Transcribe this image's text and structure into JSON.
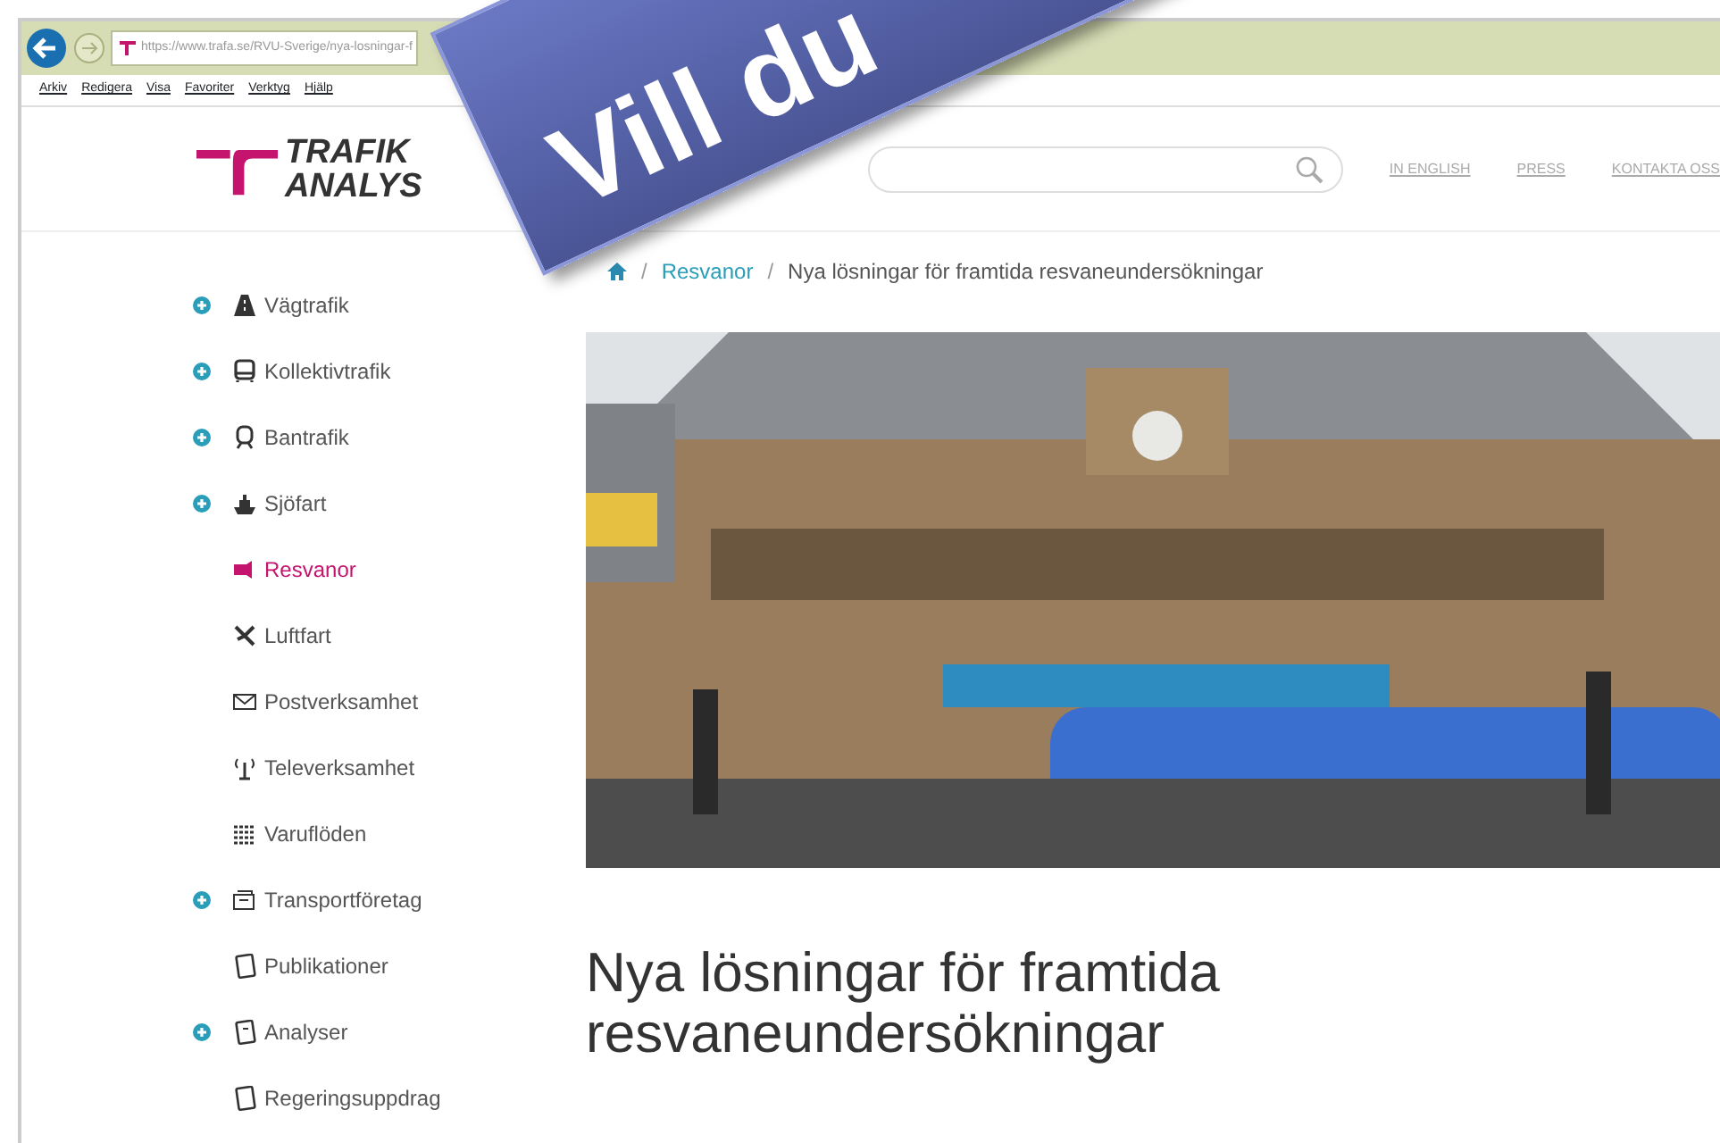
{
  "browser": {
    "url": "https://www.trafa.se/RVU-Sverige/nya-losningar-f",
    "menu": [
      "Arkiv",
      "Redigera",
      "Visa",
      "Favoriter",
      "Verktyg",
      "Hjälp"
    ]
  },
  "site": {
    "logo_line1": "TRAFIK",
    "logo_line2": "ANALYS",
    "top_links": [
      "IN ENGLISH",
      "PRESS",
      "KONTAKTA OSS"
    ]
  },
  "sidebar": {
    "items": [
      {
        "label": "Vägtrafik",
        "expandable": true,
        "selected": false
      },
      {
        "label": "Kollektivtrafik",
        "expandable": true,
        "selected": false
      },
      {
        "label": "Bantrafik",
        "expandable": true,
        "selected": false
      },
      {
        "label": "Sjöfart",
        "expandable": true,
        "selected": false
      },
      {
        "label": "Resvanor",
        "expandable": false,
        "selected": true
      },
      {
        "label": "Luftfart",
        "expandable": false,
        "selected": false
      },
      {
        "label": "Postverksamhet",
        "expandable": false,
        "selected": false
      },
      {
        "label": "Televerksamhet",
        "expandable": false,
        "selected": false
      },
      {
        "label": "Varuflöden",
        "expandable": false,
        "selected": false
      },
      {
        "label": "Transportföretag",
        "expandable": true,
        "selected": false
      },
      {
        "label": "Publikationer",
        "expandable": false,
        "selected": false
      },
      {
        "label": "Analyser",
        "expandable": true,
        "selected": false
      },
      {
        "label": "Regeringsuppdrag",
        "expandable": false,
        "selected": false
      }
    ]
  },
  "breadcrumb": [
    "Resvanor",
    "Nya lösningar för framtida resvaneundersökningar"
  ],
  "breadcrumb_separators": [
    "/",
    "/"
  ],
  "article": {
    "title": "Nya lösningar för framtida resvaneundersökningar"
  },
  "banner": {
    "text": "Vill du"
  }
}
